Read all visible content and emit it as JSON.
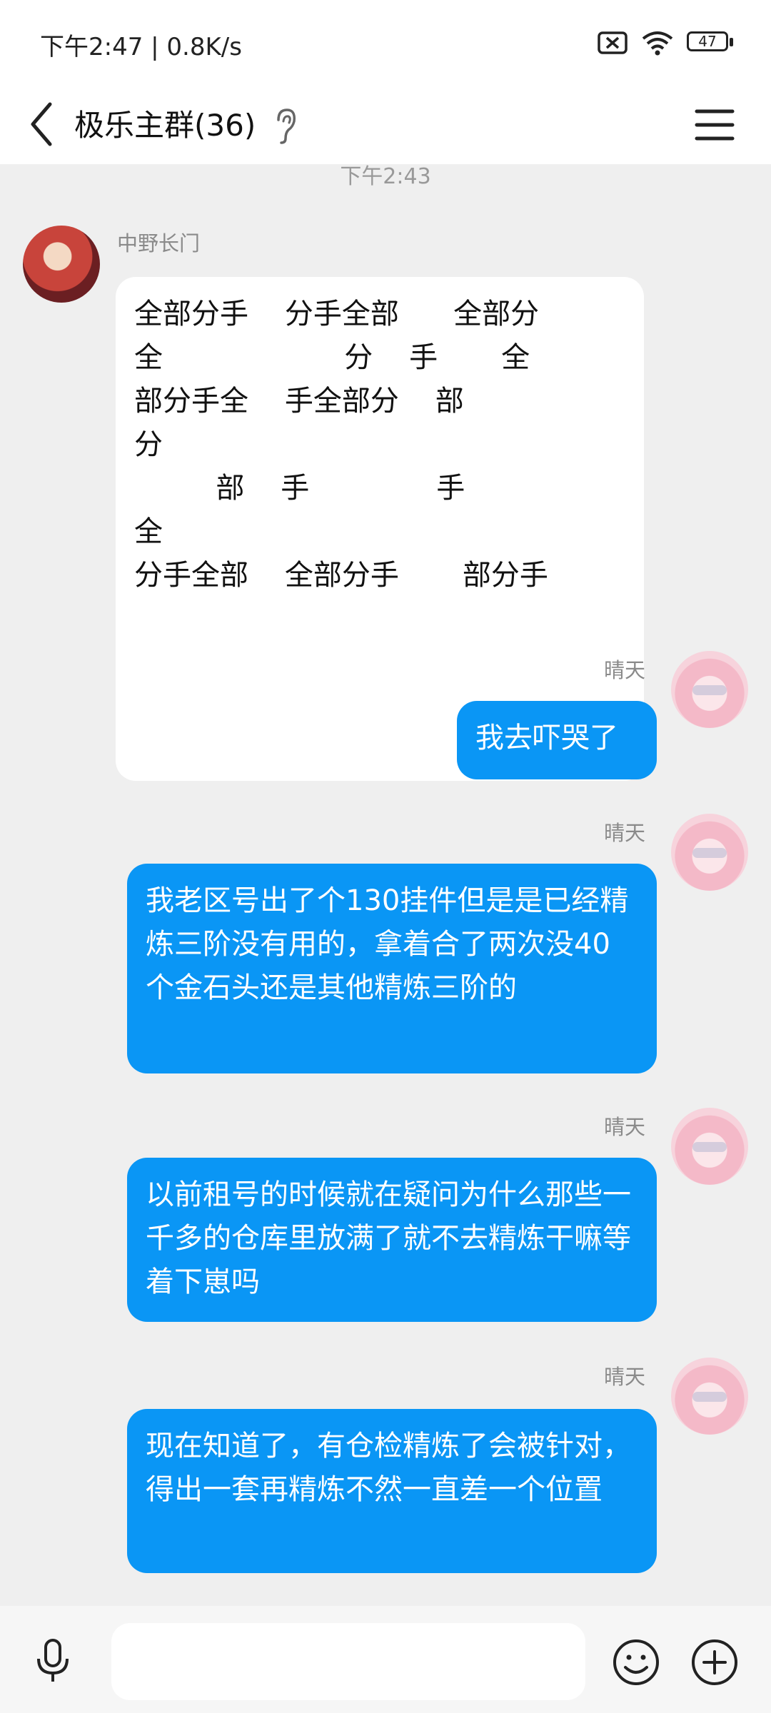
{
  "status": {
    "time": "下午2:47 | 0.8K/s",
    "battery": "47"
  },
  "header": {
    "title": "极乐主群(36)"
  },
  "chat": {
    "timestamp": "下午2:43",
    "messages": [
      {
        "sender": "中野长门",
        "direction": "incoming",
        "lines": [
          "全部分手    分手全部      全部分",
          "全                    分    手       全",
          "部分手全    手全部分    部",
          "分",
          "         部    手              手",
          "全",
          "分手全部    全部分手       部分手"
        ]
      },
      {
        "sender": "晴天",
        "direction": "outgoing",
        "text": "我去吓哭了"
      },
      {
        "sender": "晴天",
        "direction": "outgoing",
        "text": "我老区号出了个130挂件但是是已经精炼三阶没有用的，拿着合了两次没40个金石头还是其他精炼三阶的"
      },
      {
        "sender": "晴天",
        "direction": "outgoing",
        "text": "以前租号的时候就在疑问为什么那些一千多的仓库里放满了就不去精炼干嘛等着下崽吗"
      },
      {
        "sender": "晴天",
        "direction": "outgoing",
        "text": "现在知道了，有仓检精炼了会被针对，得出一套再精炼不然一直差一个位置"
      }
    ]
  },
  "input": {
    "placeholder": ""
  },
  "colors": {
    "outgoing_bubble": "#0a96f5",
    "incoming_bubble": "#ffffff",
    "background": "#efefef"
  },
  "icons": [
    "back-icon",
    "ear-icon",
    "menu-icon",
    "mic-icon",
    "emoji-icon",
    "plus-icon",
    "wifi-icon",
    "battery-icon",
    "sim-off-icon"
  ]
}
